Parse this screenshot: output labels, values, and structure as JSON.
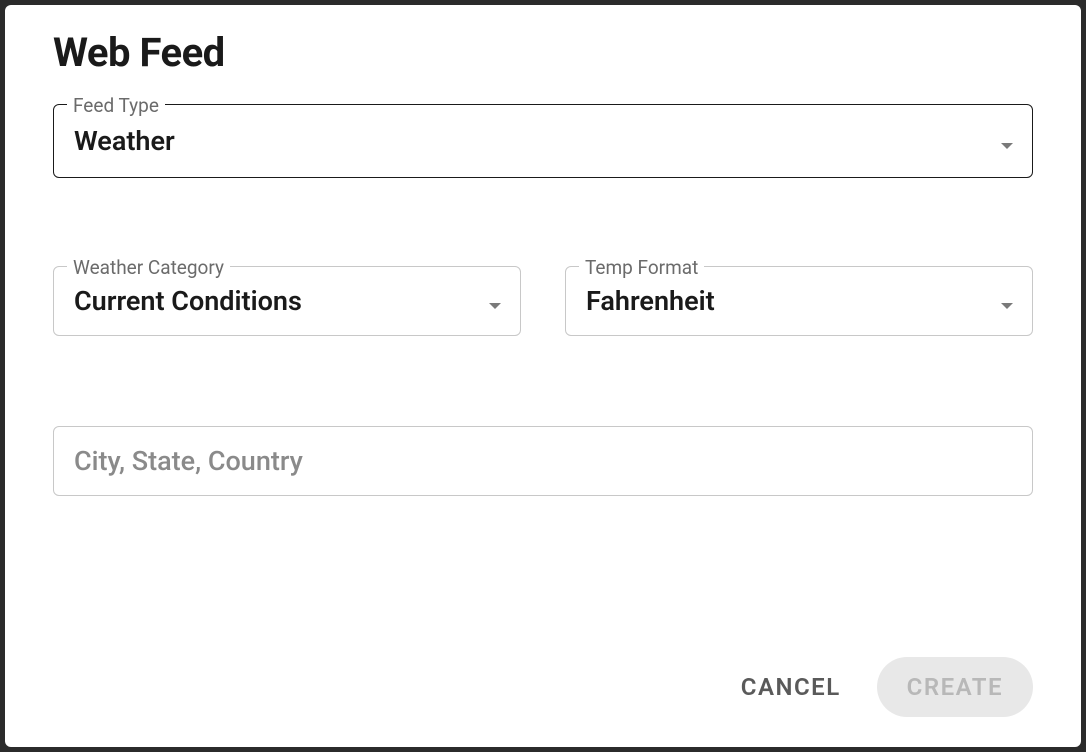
{
  "dialog": {
    "title": "Web Feed"
  },
  "fields": {
    "feed_type": {
      "label": "Feed Type",
      "value": "Weather"
    },
    "weather_category": {
      "label": "Weather Category",
      "value": "Current Conditions"
    },
    "temp_format": {
      "label": "Temp Format",
      "value": "Fahrenheit"
    },
    "location": {
      "placeholder": "City, State, Country",
      "value": ""
    }
  },
  "actions": {
    "cancel": "CANCEL",
    "create": "CREATE"
  }
}
